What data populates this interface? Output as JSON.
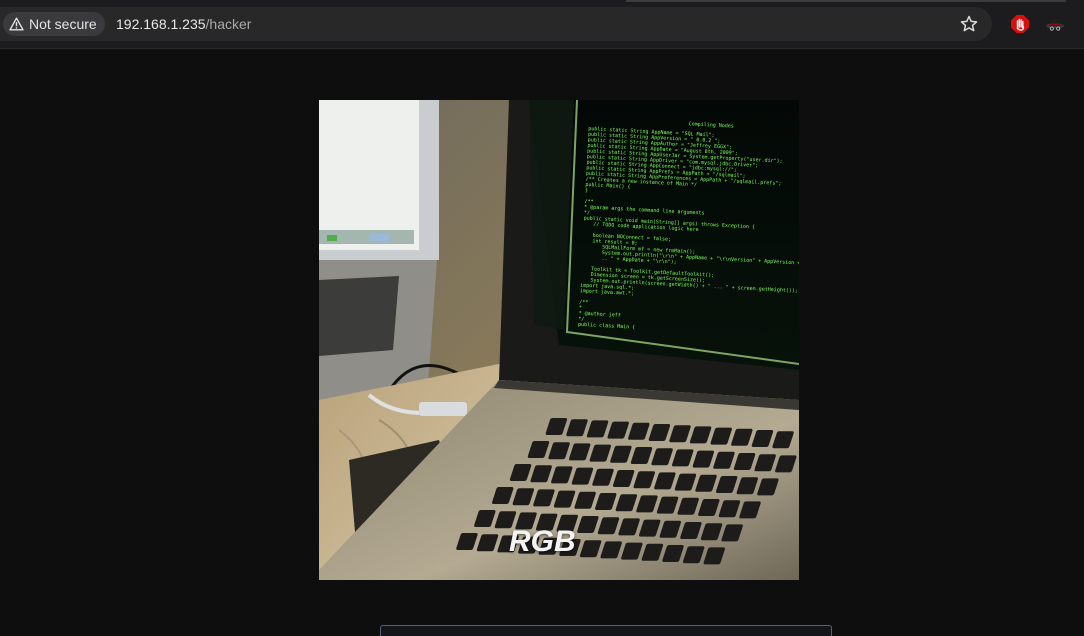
{
  "browser": {
    "security_label": "Not secure",
    "url_host": "192.168.1.235",
    "url_path": "/hacker",
    "icons": {
      "security": "warning-triangle-icon",
      "bookmark": "star-icon",
      "extension_1": "stop-hand-icon",
      "extension_2": "spy-hat-icon"
    }
  },
  "page": {
    "image_watermark": "RGB",
    "code_title": "Compiling Nodes",
    "code_lines": [
      "public static String AppName = \"SQL Mail\";",
      "public static String AppVersion = \" 0.0.2 \";",
      "public static String AppAuthor = \"Jeffrey EGGX\";",
      "public static String AppDate = \"August 8th, 2009\";",
      "public static String AppUserJar = System.getProperty(\"user.dir\");",
      "public static String AppDriver = \"com.mysql.jdbc.Driver\";",
      "public static String AppConnect = \"jdbc:mysql://\";",
      "public static String AppPrefs = AppPath + \"/sqlmail\";",
      "public static String AppPreferences = AppPath + \"/sqlmail.prefs\";",
      "/** Creates a new instance of Main */",
      "public Main() {",
      "}",
      "",
      "/**",
      " * @param args the command line arguments",
      " */",
      "public static void main(String[] args) throws Exception {",
      "  // TODO code application logic here",
      "",
      "  boolean NOConnect = false;",
      "  int result = 0;",
      "  SQLMailForm mf = new frmMain();",
      "  System.out.println(\"\\r\\n\" + AppName + \"\\r\\nVersion\" + AppVersion + \"\\r\\nAuthor",
      "  .. \" + AppDate + \"\\r\\n\");",
      "",
      "  Toolkit tk = Toolkit.getDefaultToolkit();",
      "  Dimension screen = tk.getScreenSize();",
      "  System.out.println(screen.getWidth() + \" ... \" + screen.getHeight());",
      "import java.sql.*;",
      "import java.awt.*;",
      "",
      "/**",
      " *",
      " * @author jeff",
      " */",
      "public class Main {"
    ]
  },
  "colors": {
    "code_green": "#7cff5a",
    "toolbar": "#1c1c1e",
    "page_bg": "#0e0e0e",
    "stop_red": "#d60f0f"
  }
}
